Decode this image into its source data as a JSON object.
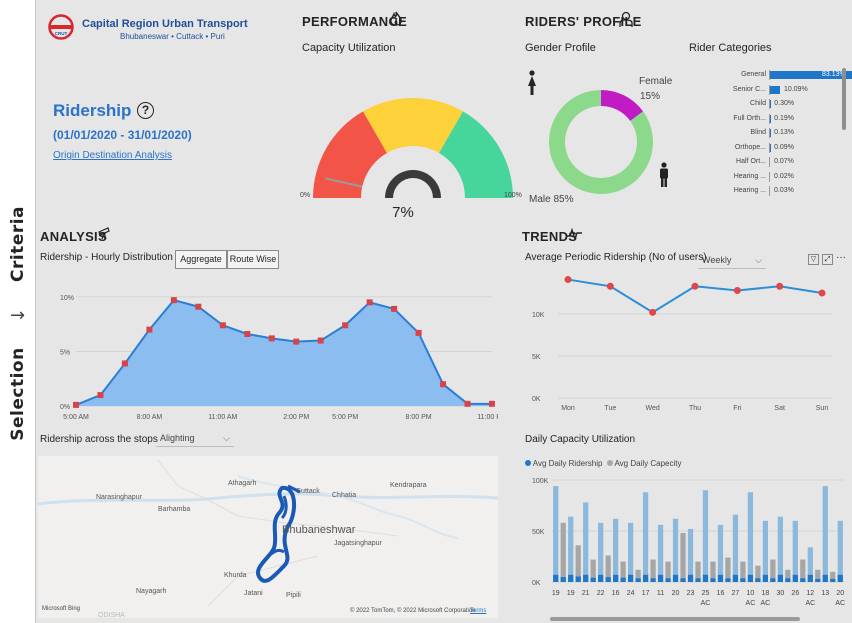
{
  "sidebar": {
    "criteria_label": "Criteria",
    "selection_label": "Selection",
    "arrow": "→"
  },
  "header": {
    "org_name": "Capital Region Urban Transport",
    "org_sub": "Bhubaneswar • Cuttack • Puri",
    "logo_text": "CRUT",
    "title": "Ridership",
    "date_range": "(01/01/2020 - 31/01/2020)",
    "link_label": "Origin Destination Analysis",
    "help_icon": "question-circle-icon"
  },
  "performance": {
    "title": "PERFORMANCE",
    "icon": "flame-icon",
    "subtitle": "Capacity Utilization",
    "value_label": "7%",
    "value": 7,
    "min_label": "0%",
    "max_label": "100%",
    "colors": [
      "#f25447",
      "#fcd13a",
      "#46d59b"
    ]
  },
  "riders_profile": {
    "title": "RIDERS' PROFILE",
    "icon": "person-icon",
    "gender_title": "Gender Profile",
    "female_label": "Female",
    "female_pct": "15%",
    "male_label": "Male 85%",
    "female_value": 15,
    "male_value": 85,
    "female_color": "#c11bc6",
    "male_color": "#8cd98c",
    "categories_title": "Rider Categories",
    "categories": [
      {
        "name": "General",
        "value": "83.13%",
        "pct": 83.13
      },
      {
        "name": "Senior C...",
        "value": "10.09%",
        "pct": 10.09
      },
      {
        "name": "Child",
        "value": "0.30%",
        "pct": 0.3
      },
      {
        "name": "Full Orth...",
        "value": "0.19%",
        "pct": 0.19
      },
      {
        "name": "Blind",
        "value": "0.13%",
        "pct": 0.13
      },
      {
        "name": "Orthope...",
        "value": "0.09%",
        "pct": 0.09
      },
      {
        "name": "Half Ort...",
        "value": "0.07%",
        "pct": 0.07
      },
      {
        "name": "Hearing ...",
        "value": "0.02%",
        "pct": 0.02
      },
      {
        "name": "Hearing ...",
        "value": "0.03%",
        "pct": 0.03
      }
    ]
  },
  "analysis": {
    "title": "ANALYSIS",
    "icon": "telescope-icon",
    "hourly_title": "Ridership - Hourly Distribution",
    "btn_aggregate": "Aggregate",
    "btn_route": "Route Wise",
    "stops_title": "Ridership across the stops",
    "stops_dropdown": "Alighting"
  },
  "trends": {
    "title": "TRENDS",
    "icon": "trend-line-icon",
    "weekly_title": "Average Periodic Ridership (No of users)",
    "weekly_dropdown": "Weekly",
    "daily_title": "Daily Capacity Utilization",
    "legend_a": "Avg Daily Ridership",
    "legend_b": "Avg Daily Capecity",
    "legend_a_color": "#1f77c9",
    "legend_b_color": "#a8a8a8"
  },
  "map": {
    "labels": [
      "Athagarh",
      "Kendrapara",
      "Narasinghapur",
      "Barhamba",
      "Cuttack",
      "Chhatia",
      "Bhubaneshwar",
      "Jagatsinghapur",
      "Khurda",
      "Nayagarh",
      "Pipili",
      "Jatani",
      "ODISHA"
    ],
    "brand": "Microsoft Bing",
    "copyright": "© 2022 TomTom, © 2022 Microsoft Corporation",
    "terms": "Terms"
  },
  "chart_data": [
    {
      "type": "area",
      "title": "Ridership - Hourly Distribution",
      "x": [
        "3:00 AM",
        "4:00 AM",
        "5:00 AM",
        "6:00 AM",
        "7:00 AM",
        "8:00 AM",
        "9:00 AM",
        "10:00 AM",
        "11:00 AM",
        "12:00 PM",
        "1:00 PM",
        "2:00 PM",
        "3:00 PM",
        "4:00 PM",
        "5:00 PM",
        "6:00 PM",
        "7:00 PM",
        "8:00 PM",
        "9:00 PM",
        "10:00 PM",
        "11:00 PM"
      ],
      "x_tick_labels": [
        "5:00 AM",
        "8:00 AM",
        "11:00 AM",
        "2:00 PM",
        "5:00 PM",
        "8:00 PM",
        "11:00 PM"
      ],
      "y_tick_labels": [
        "0%",
        "5%",
        "10%"
      ],
      "values": [
        0.1,
        1.0,
        3.9,
        7.0,
        9.7,
        9.1,
        7.4,
        6.6,
        6.2,
        5.9,
        6.0,
        7.4,
        9.5,
        8.9,
        6.7,
        2.0,
        0.2,
        0.2
      ],
      "ylim": [
        0,
        11
      ]
    },
    {
      "type": "line",
      "title": "Average Periodic Ridership (No of users)",
      "categories": [
        "Mon",
        "Tue",
        "Wed",
        "Thu",
        "Fri",
        "Sat",
        "Sun"
      ],
      "values": [
        14100,
        13300,
        10200,
        13300,
        12800,
        13300,
        12500
      ],
      "y_tick_labels": [
        "0K",
        "5K",
        "10K"
      ],
      "ylim": [
        0,
        15000
      ]
    },
    {
      "type": "bar",
      "title": "Daily Capacity Utilization",
      "categories": [
        "19",
        "",
        "19",
        "",
        "21",
        "",
        "22",
        "",
        "16",
        "",
        "24",
        "",
        "17",
        "",
        "11",
        "",
        "20",
        "",
        "23",
        "",
        "25",
        "",
        "16",
        "",
        "27",
        "",
        "10",
        "",
        "18",
        "",
        "30",
        "",
        "26",
        "",
        "12",
        "",
        "13",
        "",
        "20"
      ],
      "x_tick_labels": [
        "19",
        "19",
        "21",
        "22",
        "16",
        "24",
        "17",
        "11",
        "20",
        "23",
        "25",
        "16",
        "27",
        "10",
        "18",
        "30",
        "26",
        "12",
        "13",
        "20"
      ],
      "x_tick_sublabels": [
        "",
        "",
        "",
        "",
        "",
        "",
        "",
        "",
        "",
        "",
        "AC",
        "",
        "",
        "AC",
        "AC",
        "",
        "",
        "AC",
        "",
        "AC"
      ],
      "y_tick_labels": [
        "0K",
        "50K",
        "100K"
      ],
      "ylim": [
        0,
        100000
      ],
      "series": [
        {
          "name": "Avg Daily Ridership",
          "values": [
            66000,
            8000,
            60000,
            9000,
            48000,
            7000,
            40000,
            8000,
            38000,
            7000,
            32000,
            6000,
            30000,
            6000,
            28000,
            6000,
            30000,
            6000,
            28000,
            6000,
            28000,
            6000,
            26000,
            6000,
            28000,
            6000,
            24000,
            6000,
            20000,
            6000,
            22000,
            6000,
            20000,
            6000,
            18000,
            5000,
            14000,
            5000,
            14000
          ]
        },
        {
          "name": "Avg Daily Capecity",
          "values": [
            94000,
            58000,
            64000,
            36000,
            78000,
            22000,
            58000,
            26000,
            62000,
            20000,
            58000,
            12000,
            88000,
            22000,
            56000,
            20000,
            62000,
            48000,
            52000,
            20000,
            90000,
            20000,
            56000,
            24000,
            66000,
            20000,
            88000,
            16000,
            60000,
            22000,
            64000,
            12000,
            60000,
            22000,
            34000,
            12000,
            94000,
            10000,
            60000
          ]
        }
      ]
    }
  ]
}
